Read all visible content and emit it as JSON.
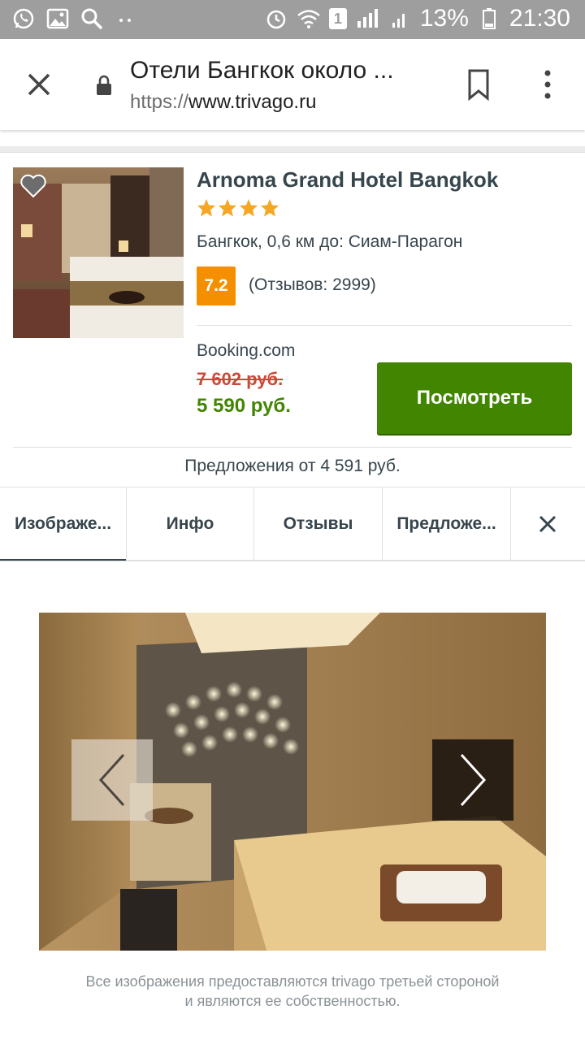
{
  "status_bar": {
    "battery": "13%",
    "time": "21:30",
    "sim_slot": "1"
  },
  "browser": {
    "title": "Отели Бангкок около ...",
    "url_scheme": "https://",
    "url_host": "www.trivago.ru"
  },
  "hotel": {
    "name": "Arnoma Grand Hotel Bangkok",
    "stars": 4,
    "location": "Бангкок, 0,6 км до: Сиам-Парагон",
    "rating": "7.2",
    "reviews": "(Отзывов: 2999)",
    "provider": "Booking.com",
    "old_price": "7 602 руб.",
    "new_price": "5 590 руб.",
    "view_button": "Посмотреть",
    "offers_link": "Предложения от 4 591 руб."
  },
  "tabs": [
    {
      "label": "Изображе...",
      "active": true
    },
    {
      "label": "Инфо",
      "active": false
    },
    {
      "label": "Отзывы",
      "active": false
    },
    {
      "label": "Предложе...",
      "active": false
    }
  ],
  "gallery": {
    "disclaimer_line1": "Все изображения предоставляются trivago третьей стороной",
    "disclaimer_line2": "и являются ее собственностью."
  },
  "colors": {
    "accent_green": "#428500",
    "old_price_red": "#c94a38",
    "rating_orange": "#f48f00",
    "star": "#f5a623",
    "status_bar": "#9e9e9e"
  }
}
